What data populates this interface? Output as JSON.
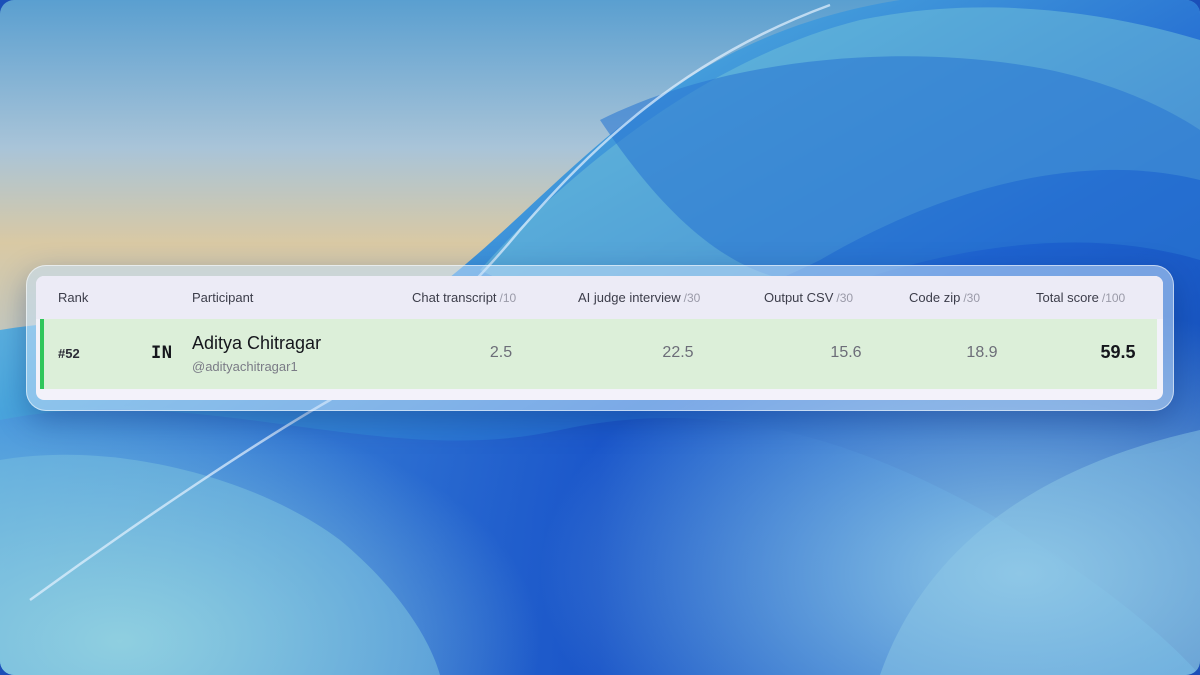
{
  "table": {
    "columns": {
      "rank": {
        "label": "Rank"
      },
      "participant": {
        "label": "Participant"
      },
      "chat_transcript": {
        "label": "Chat transcript",
        "max": "/10"
      },
      "ai_judge_interview": {
        "label": "AI judge interview",
        "max": "/30"
      },
      "output_csv": {
        "label": "Output CSV",
        "max": "/30"
      },
      "code_zip": {
        "label": "Code zip",
        "max": "/30"
      },
      "total_score": {
        "label": "Total score",
        "max": "/100"
      }
    },
    "rows": [
      {
        "rank": "#52",
        "country_code": "IN",
        "name": "Aditya Chitragar",
        "handle": "@adityachitragar1",
        "chat_transcript": "2.5",
        "ai_judge_interview": "22.5",
        "output_csv": "15.6",
        "code_zip": "18.9",
        "total_score": "59.5"
      }
    ]
  },
  "colors": {
    "row_highlight": "#dcefd9",
    "row_accent": "#2fc65a",
    "header_bg": "#ecebf6",
    "panel_bg": "#f3f2fa",
    "wallpaper_blue": "#1b4fb8"
  }
}
